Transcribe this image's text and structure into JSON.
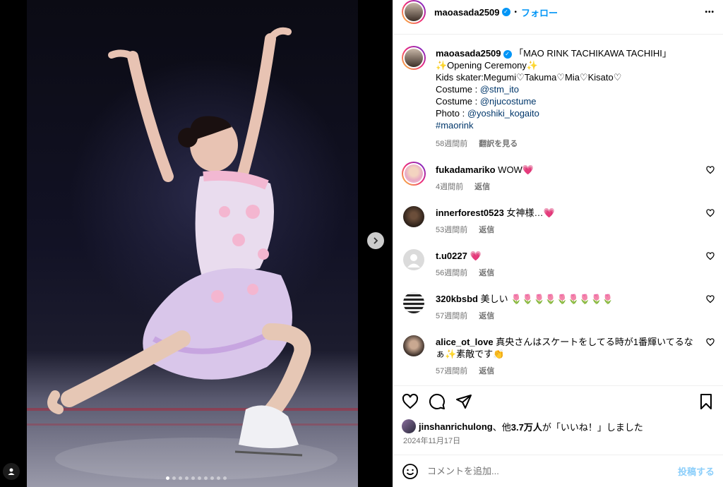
{
  "post": {
    "author": "maoasada2509",
    "follow_label": "フォロー",
    "separator": "•",
    "more_label": "•••",
    "caption_lines": [
      "「MAO RINK TACHIKAWA TACHIHI」",
      "✨Opening Ceremony✨",
      "Kids skater:Megumi♡Takuma♡Mia♡Kisato♡"
    ],
    "credits": [
      {
        "label": "Costume : ",
        "handle": "@stm_ito"
      },
      {
        "label": "Costume : ",
        "handle": "@njucostume"
      },
      {
        "label": "Photo : ",
        "handle": "@yoshiki_kogaito"
      }
    ],
    "hashtag": "#maorink",
    "time_ago": "58週間前",
    "translate_label": "翻訳を見る"
  },
  "comments": [
    {
      "user": "fukadamariko",
      "text": "WOW💗",
      "time": "4週間前",
      "reply": "返信",
      "avatar": "pink-portrait"
    },
    {
      "user": "innerforest0523",
      "text": "女神様…💗",
      "time": "53週間前",
      "reply": "返信",
      "avatar": "dark-portrait"
    },
    {
      "user": "t.u0227",
      "text": "💗",
      "time": "56週間前",
      "reply": "返信",
      "avatar": "default-user"
    },
    {
      "user": "320kbsbd",
      "text": "美しい 🌷🌷🌷🌷🌷🌷🌷🌷🌷",
      "time": "57週間前",
      "reply": "返信",
      "avatar": "pattern"
    },
    {
      "user": "alice_ot_love",
      "text": "真央さんはスケートをしてる時が1番輝いてるなぁ✨素敵です👏",
      "time": "57週間前",
      "reply": "返信",
      "avatar": "face-portrait"
    }
  ],
  "likes": {
    "user": "jinshanrichulong",
    "mid": "、他",
    "count": "3.7万人",
    "suffix": "が「いいね！」しました"
  },
  "date": "2024年11月17日",
  "comment_input": {
    "placeholder": "コメントを追加...",
    "post_label": "投稿する"
  },
  "carousel": {
    "count": 10,
    "active": 0
  },
  "colors": {
    "accent": "#0095f6",
    "like": "#ed4956",
    "muted": "#737373"
  }
}
